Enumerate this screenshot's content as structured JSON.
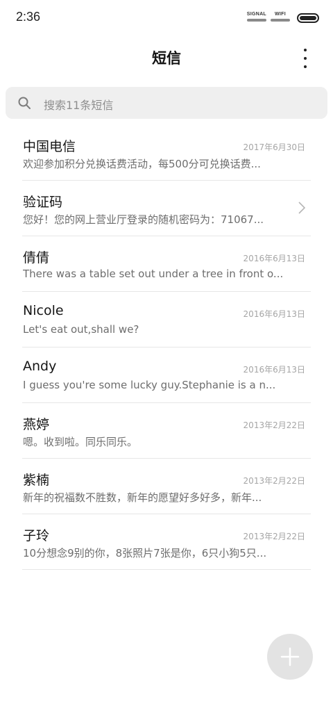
{
  "status_bar": {
    "time": "2:36",
    "signal_label": "SIGNAL",
    "wifi_label": "WIFI"
  },
  "header": {
    "title": "短信",
    "more_icon": "more-vertical-icon"
  },
  "search": {
    "placeholder": "搜索11条短信",
    "icon": "search-icon"
  },
  "conversations": [
    {
      "name": "中国电信",
      "date": "2017年6月30日",
      "preview": "欢迎参加积分兑换话费活动，每500分可兑换话费..."
    },
    {
      "name": "验证码",
      "date": "",
      "preview": "您好！您的网上营业厅登录的随机密码为：71067..."
    },
    {
      "name": "倩倩",
      "date": "2016年6月13日",
      "preview": "There was a table set out under a tree in front o..."
    },
    {
      "name": "Nicole",
      "date": "2016年6月13日",
      "preview": "Let's eat out,shall we?"
    },
    {
      "name": "Andy",
      "date": "2016年6月13日",
      "preview": "I guess you're some lucky guy.Stephanie is a n..."
    },
    {
      "name": "燕婷",
      "date": "2013年2月22日",
      "preview": "嗯。收到啦。同乐同乐。"
    },
    {
      "name": "紫楠",
      "date": "2013年2月22日",
      "preview": "新年的祝福数不胜数，新年的愿望好多好多，新年..."
    },
    {
      "name": "子玲",
      "date": "2013年2月22日",
      "preview": "10分想念9别的你，8张照片7张是你，6只小狗5只..."
    }
  ],
  "fab": {
    "icon": "plus-icon"
  },
  "colors": {
    "search_bg": "#efefef",
    "fab_bg": "#e3e3e3",
    "divider": "#e6e6e6"
  }
}
